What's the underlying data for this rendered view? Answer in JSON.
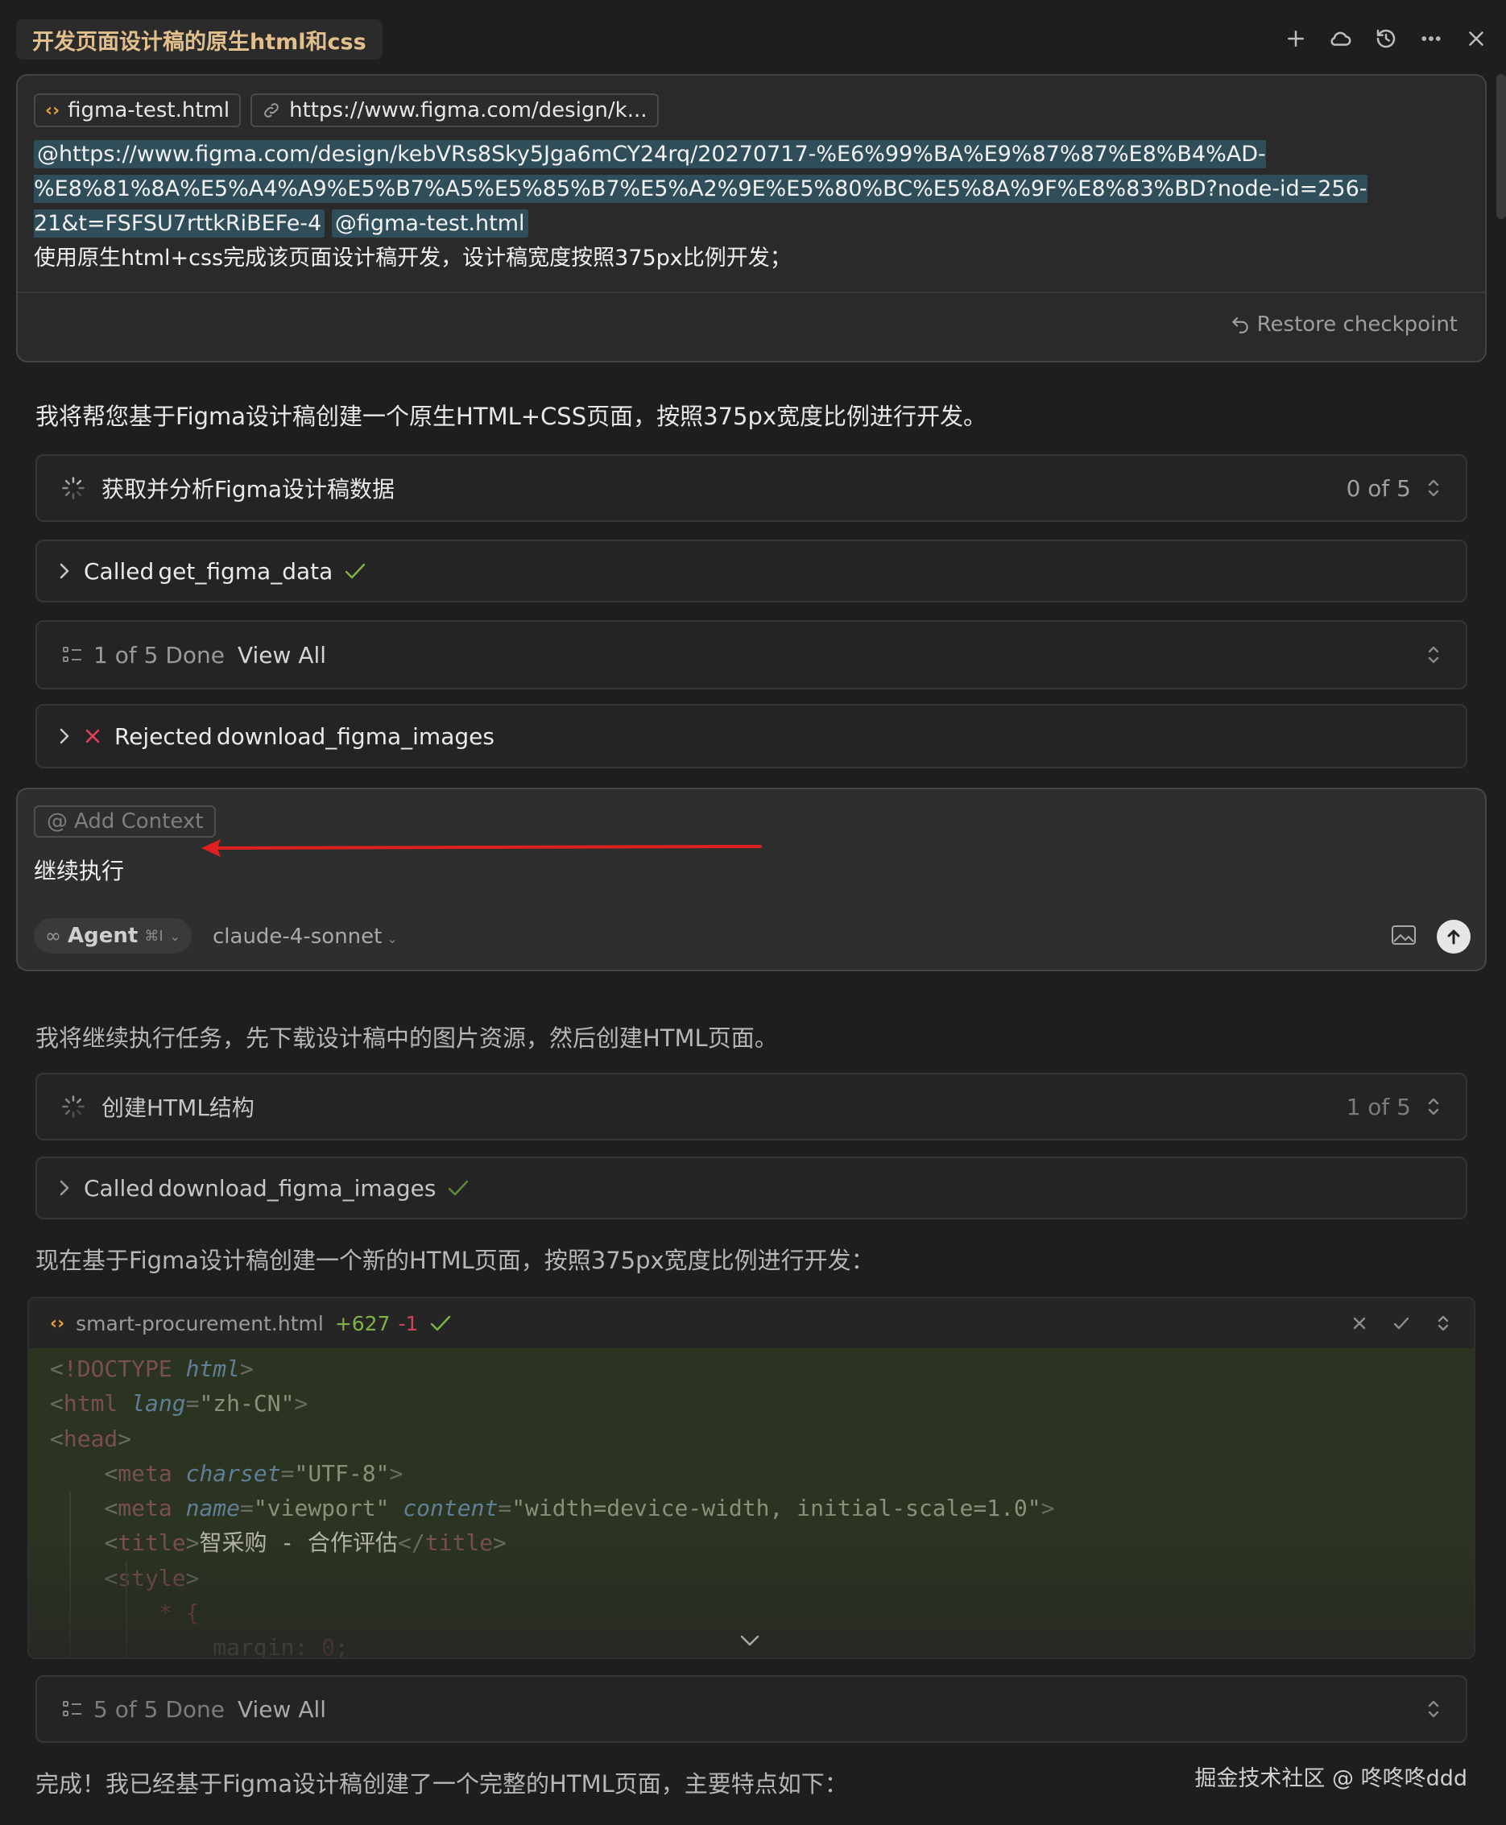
{
  "header": {
    "title": "开发页面设计稿的原生html和css",
    "icons": [
      "plus-icon",
      "cloud-icon",
      "history-icon",
      "more-icon",
      "close-icon"
    ]
  },
  "user_message": {
    "chips": [
      {
        "icon": "code-file-icon",
        "label": "figma-test.html"
      },
      {
        "icon": "link-icon",
        "label": "https://www.figma.com/design/k..."
      }
    ],
    "mention_link_1": "@https://www.figma.com/design/kebVRs8Sky5Jga6mCY24rq/20270717-%E6%99%BA%E9%87%87%E8%B4%AD-",
    "mention_link_2": "%E8%81%8A%E5%A4%A9%E5%B7%A5%E5%85%B7%E5%A2%9E%E5%80%BC%E5%8A%9F%E8%83%BD?node-id=256-",
    "mention_link_3": "21&t=FSFSU7rttkRiBEFe-4",
    "mention_file": "@figma-test.html",
    "instruction": "使用原生html+css完成该页面设计稿开发，设计稿宽度按照375px比例开发；",
    "restore_label": "Restore checkpoint"
  },
  "response_1": {
    "intro": "我将帮您基于Figma设计稿创建一个原生HTML+CSS页面，按照375px宽度比例进行开发。",
    "task": {
      "title": "获取并分析Figma设计稿数据",
      "progress": "0 of 5"
    },
    "tool_call": {
      "prefix": "Called",
      "name": "get_figma_data"
    },
    "todo": {
      "count": "1 of 5 Done",
      "view_all": "View All"
    },
    "rejected": {
      "prefix": "Rejected",
      "name": "download_figma_images"
    }
  },
  "input": {
    "add_context": "Add Context",
    "text": "继续执行",
    "mode": "Agent",
    "shortcut": "⌘I",
    "model": "claude-4-sonnet"
  },
  "response_2": {
    "intro": "我将继续执行任务，先下载设计稿中的图片资源，然后创建HTML页面。",
    "task": {
      "title": "创建HTML结构",
      "progress": "1 of 5"
    },
    "tool_call": {
      "prefix": "Called",
      "name": "download_figma_images"
    },
    "lead": "现在基于Figma设计稿创建一个新的HTML页面，按照375px宽度比例进行开发：",
    "code": {
      "filename": "smart-procurement.html",
      "added": "+627",
      "removed": "-1",
      "title_text": "智采购 - 合作评估"
    },
    "todo": {
      "count": "5 of 5 Done",
      "view_all": "View All"
    },
    "summary": "完成！我已经基于Figma设计稿创建了一个完整的HTML页面，主要特点如下："
  },
  "watermark": "掘金技术社区 @ 咚咚咚ddd",
  "colors": {
    "accent_title": "#e2c08d",
    "success": "#7fb347",
    "error": "#e0445a",
    "arrow": "#e02020",
    "code_bg": "#2b3321"
  }
}
